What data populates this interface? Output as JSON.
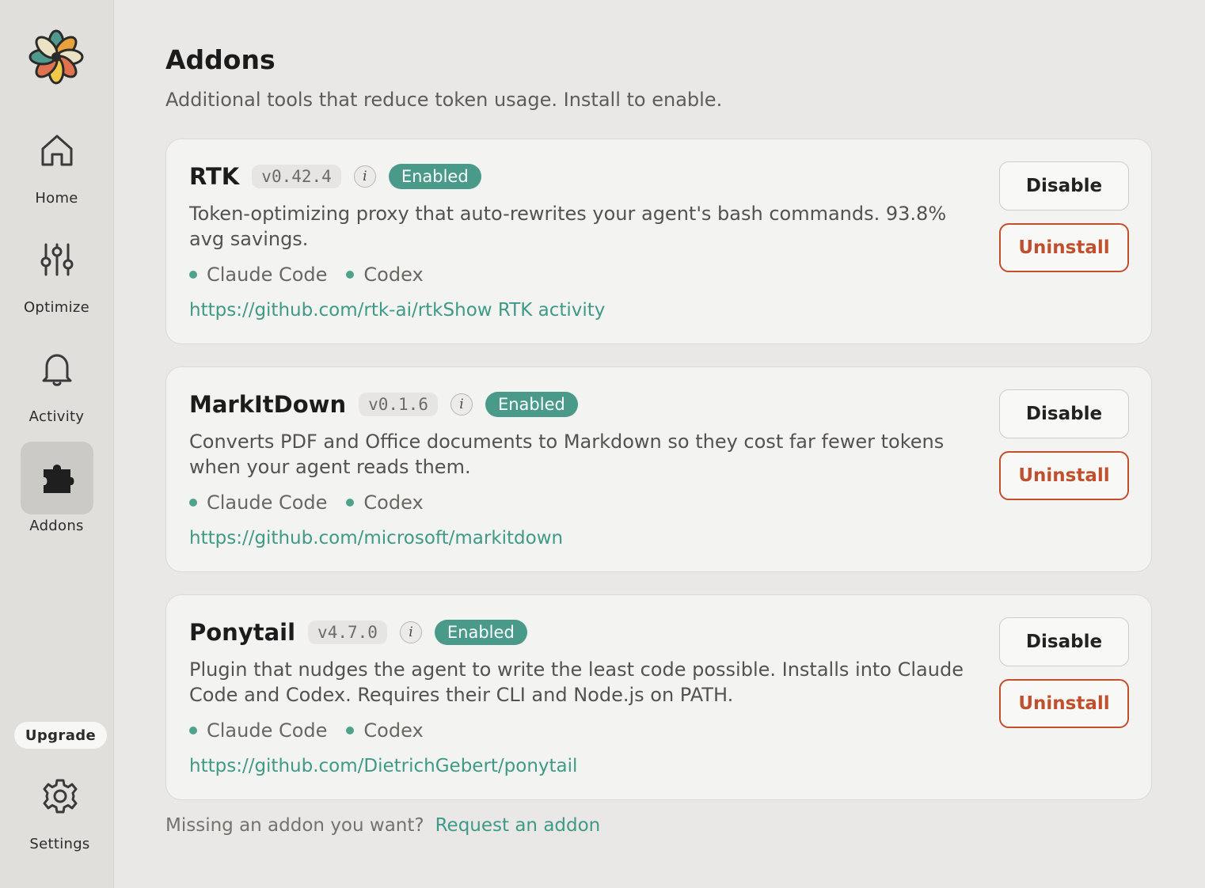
{
  "sidebar": {
    "logo_icon": "flower-logo-icon",
    "items": [
      {
        "label": "Home",
        "icon": "home-icon"
      },
      {
        "label": "Optimize",
        "icon": "sliders-icon"
      },
      {
        "label": "Activity",
        "icon": "bell-icon"
      },
      {
        "label": "Addons",
        "icon": "puzzle-icon",
        "active": true
      }
    ],
    "upgrade_label": "Upgrade",
    "settings": {
      "label": "Settings",
      "icon": "gear-icon"
    }
  },
  "page": {
    "title": "Addons",
    "subtitle": "Additional tools that reduce token usage. Install to enable."
  },
  "addons": [
    {
      "name": "RTK",
      "version": "v0.42.4",
      "status": "Enabled",
      "description": "Token-optimizing proxy that auto-rewrites your agent's bash commands. 93.8% avg savings.",
      "tags": [
        "Claude Code",
        "Codex"
      ],
      "link": "https://github.com/rtk-ai/rtk",
      "extra_link": "Show RTK activity",
      "disable_label": "Disable",
      "uninstall_label": "Uninstall"
    },
    {
      "name": "MarkItDown",
      "version": "v0.1.6",
      "status": "Enabled",
      "description": "Converts PDF and Office documents to Markdown so they cost far fewer tokens when your agent reads them.",
      "tags": [
        "Claude Code",
        "Codex"
      ],
      "link": "https://github.com/microsoft/markitdown",
      "disable_label": "Disable",
      "uninstall_label": "Uninstall"
    },
    {
      "name": "Ponytail",
      "version": "v4.7.0",
      "status": "Enabled",
      "description": "Plugin that nudges the agent to write the least code possible. Installs into Claude Code and Codex. Requires their CLI and Node.js on PATH.",
      "tags": [
        "Claude Code",
        "Codex"
      ],
      "link": "https://github.com/DietrichGebert/ponytail",
      "disable_label": "Disable",
      "uninstall_label": "Uninstall"
    }
  ],
  "info_glyph": "i",
  "footer": {
    "text": "Missing an addon you want?",
    "link": "Request an addon"
  },
  "colors": {
    "accent": "#4a9a8a",
    "danger": "#c0502d",
    "background": "#e9e8e6"
  }
}
